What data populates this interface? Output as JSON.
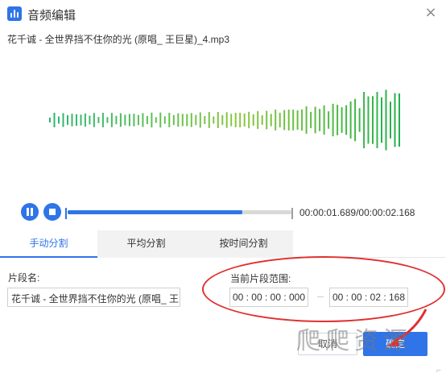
{
  "window": {
    "title": "音频编辑",
    "close_glyph": "×"
  },
  "file": {
    "name": "花千诚 - 全世界挡不住你的光 (原唱_ 王巨星)_4.mp3"
  },
  "player": {
    "time_display": "00:00:01.689/00:00:02.168",
    "progress": 0.78
  },
  "tabs": [
    {
      "label": "手动分割",
      "active": true
    },
    {
      "label": "平均分割",
      "active": false
    },
    {
      "label": "按时间分割",
      "active": false
    }
  ],
  "segment": {
    "name_label": "片段名:",
    "name_value": "花千诚 - 全世界挡不住你的光 (原唱_ 王",
    "range_label": "当前片段范围:",
    "start_time": "00 : 00 : 00 : 000",
    "end_time": "00 : 00 : 02 : 168"
  },
  "buttons": {
    "cancel_label": "取消",
    "ok_label": "确定"
  },
  "watermark": {
    "text": "爬爬资源"
  },
  "colors": {
    "accent": "#2f74e8",
    "annotation": "#e03030",
    "wave_start": "#2bb673",
    "wave_mid": "#8cc63f",
    "wave_end": "#22b14c"
  },
  "icons": {
    "app": "audio-bars-icon",
    "close": "close-icon",
    "pause": "pause-icon",
    "stop": "stop-icon",
    "arrow": "red-arrow-icon"
  }
}
